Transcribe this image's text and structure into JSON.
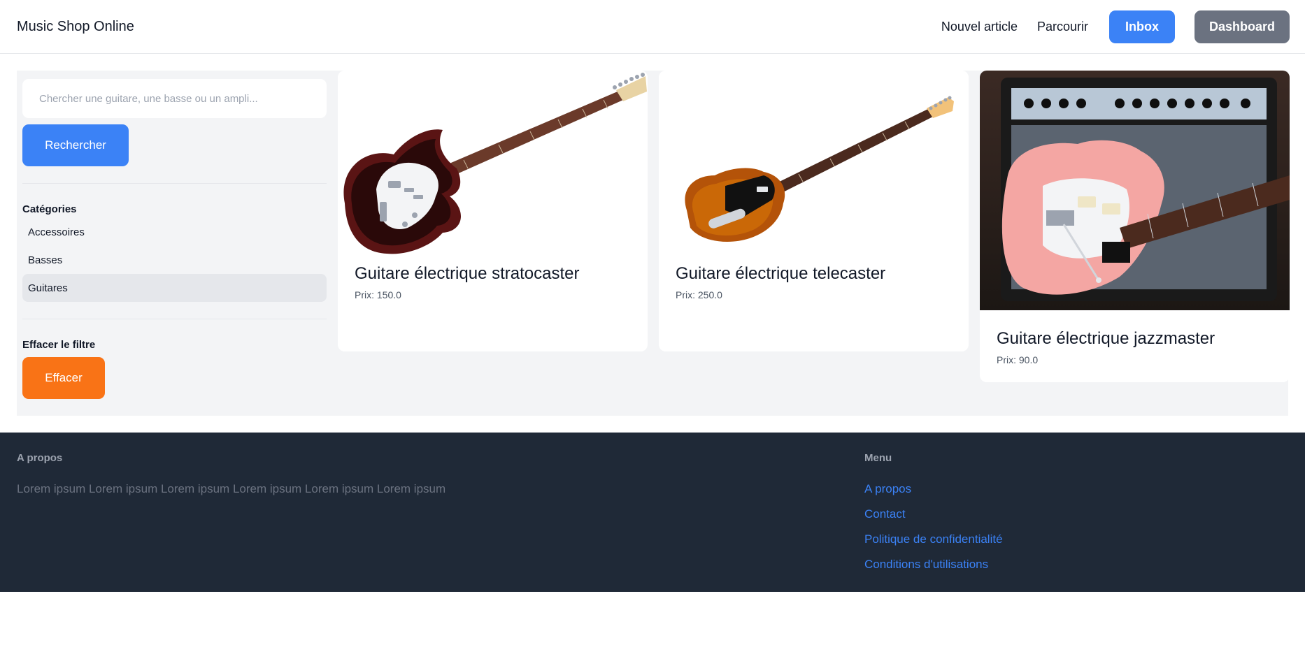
{
  "header": {
    "brand": "Music Shop Online",
    "nav": {
      "new_article": "Nouvel article",
      "browse": "Parcourir",
      "inbox": "Inbox",
      "dashboard": "Dashboard"
    }
  },
  "sidebar": {
    "search_placeholder": "Chercher une guitare, une basse ou un ampli...",
    "search_button": "Rechercher",
    "categories_title": "Catégories",
    "categories": [
      {
        "label": "Accessoires",
        "active": false
      },
      {
        "label": "Basses",
        "active": false
      },
      {
        "label": "Guitares",
        "active": true
      }
    ],
    "clear_title": "Effacer le filtre",
    "clear_button": "Effacer"
  },
  "products": [
    {
      "title": "Guitare électrique stratocaster",
      "price": "Prix: 150.0",
      "image": "stratocaster-guitar-photo"
    },
    {
      "title": "Guitare électrique telecaster",
      "price": "Prix: 250.0",
      "image": "telecaster-guitar-photo"
    },
    {
      "title": "Guitare électrique jazzmaster",
      "price": "Prix: 90.0",
      "image": "jazzmaster-guitar-amp-photo"
    }
  ],
  "footer": {
    "about_title": "A propos",
    "about_text": "Lorem ipsum Lorem ipsum Lorem ipsum Lorem ipsum Lorem ipsum Lorem ipsum",
    "menu_title": "Menu",
    "menu_links": [
      "A propos",
      "Contact",
      "Politique de confidentialité",
      "Conditions d'utilisations"
    ]
  },
  "colors": {
    "primary": "#3b82f6",
    "secondary": "#6b7280",
    "accent": "#f97316",
    "footer_bg": "#1f2937"
  }
}
